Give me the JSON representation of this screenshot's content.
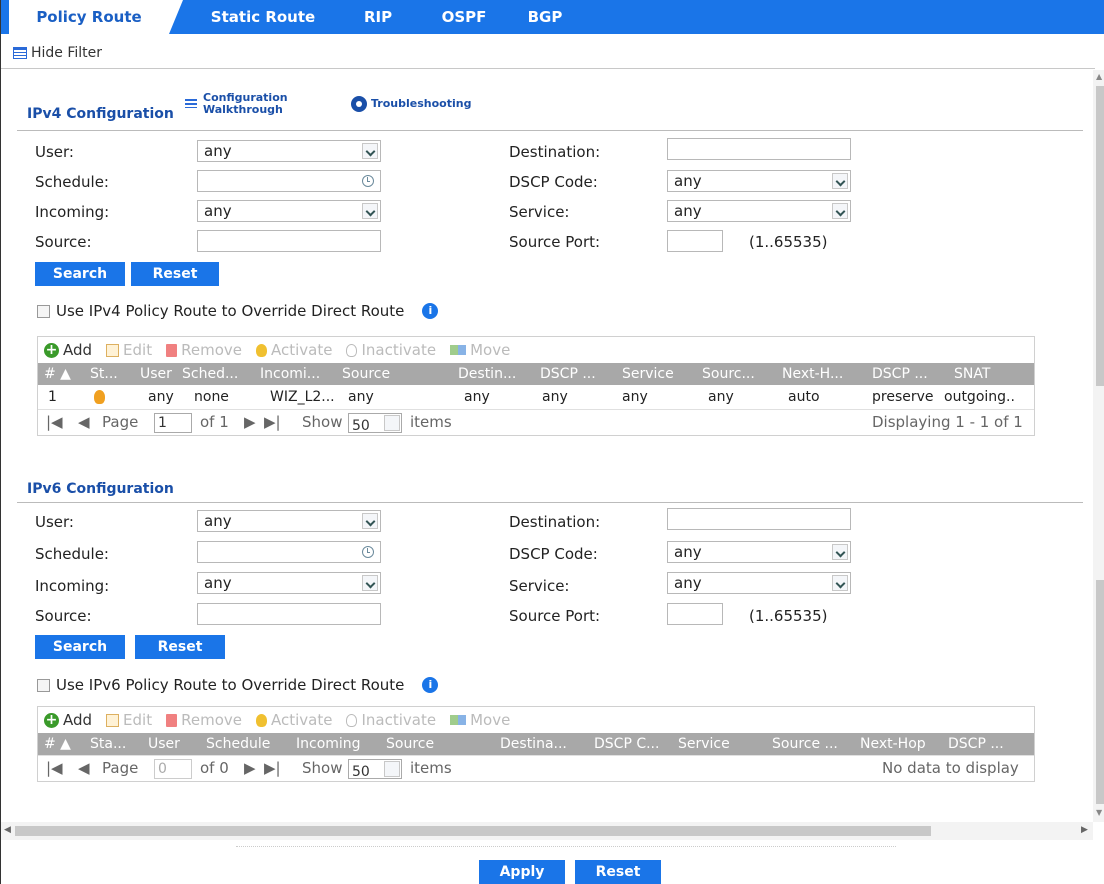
{
  "tabs": [
    {
      "label": "Policy Route"
    },
    {
      "label": "Static Route"
    },
    {
      "label": "RIP"
    },
    {
      "label": "OSPF"
    },
    {
      "label": "BGP"
    }
  ],
  "hide_filter": "Hide Filter",
  "ipv4": {
    "title": "IPv4 Configuration",
    "walkthrough_1": "Configuration",
    "walkthrough_2": "Walkthrough",
    "troubleshooting": "Troubleshooting",
    "user_label": "User:",
    "user_value": "any",
    "schedule_label": "Schedule:",
    "schedule_value": "",
    "incoming_label": "Incoming:",
    "incoming_value": "any",
    "source_label": "Source:",
    "source_value": "",
    "destination_label": "Destination:",
    "destination_value": "",
    "dscp_label": "DSCP Code:",
    "dscp_value": "any",
    "service_label": "Service:",
    "service_value": "any",
    "sport_label": "Source Port:",
    "sport_value": "",
    "sport_range": "(1..65535)",
    "search": "Search",
    "reset": "Reset",
    "override": "Use IPv4 Policy Route to Override Direct Route",
    "columns": [
      "# ▲",
      "St...",
      "User",
      "Sched...",
      "Incomi...",
      "Source",
      "Destin...",
      "DSCP ...",
      "Service",
      "Sourc...",
      "Next-H...",
      "DSCP ...",
      "SNAT"
    ],
    "rows": [
      {
        "num": "1",
        "user": "any",
        "schedule": "none",
        "incoming": "WIZ_L2...",
        "source": "any",
        "destination": "any",
        "dscp": "any",
        "service": "any",
        "source_port": "any",
        "next_hop": "auto",
        "dscp_mark": "preserve",
        "snat": "outgoing.."
      }
    ],
    "page_label": "Page",
    "page_value": "1",
    "of_label": "of 1",
    "show_label": "Show",
    "show_value": "50",
    "items_label": "items",
    "display": "Displaying 1 - 1 of 1"
  },
  "ipv6": {
    "title": "IPv6 Configuration",
    "user_label": "User:",
    "user_value": "any",
    "schedule_label": "Schedule:",
    "schedule_value": "",
    "incoming_label": "Incoming:",
    "incoming_value": "any",
    "source_label": "Source:",
    "source_value": "",
    "destination_label": "Destination:",
    "destination_value": "",
    "dscp_label": "DSCP Code:",
    "dscp_value": "any",
    "service_label": "Service:",
    "service_value": "any",
    "sport_label": "Source Port:",
    "sport_value": "",
    "sport_range": "(1..65535)",
    "search": "Search",
    "reset": "Reset",
    "override": "Use IPv6 Policy Route to Override Direct Route",
    "columns": [
      "# ▲",
      "Sta...",
      "User",
      "Schedule",
      "Incoming",
      "Source",
      "Destina...",
      "DSCP C...",
      "Service",
      "Source ...",
      "Next-Hop",
      "DSCP ..."
    ],
    "page_label": "Page",
    "page_value": "0",
    "of_label": "of 0",
    "show_label": "Show",
    "show_value": "50",
    "items_label": "items",
    "display": "No data to display"
  },
  "toolbar": {
    "add": "Add",
    "edit": "Edit",
    "remove": "Remove",
    "activate": "Activate",
    "inactivate": "Inactivate",
    "move": "Move"
  },
  "footer": {
    "apply": "Apply",
    "reset": "Reset"
  },
  "colors": {
    "accent": "#1a75e8",
    "header_gray": "#a8a8a8",
    "title_blue": "#1a4fa8"
  }
}
